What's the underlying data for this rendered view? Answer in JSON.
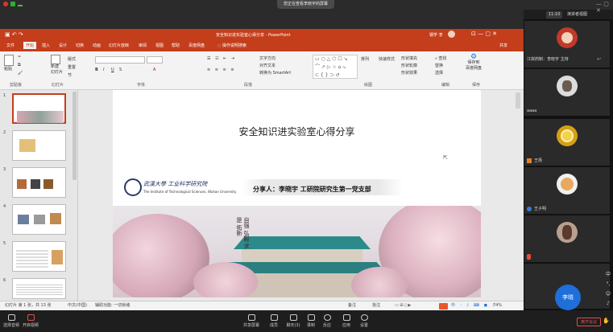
{
  "meeting": {
    "share_notice": "您正在查看李晓宇的屏幕",
    "time": "11:10",
    "layout_button": "演讲者视图",
    "chat_preview": "江岸药制：李晓宇 主持",
    "controls": [
      {
        "icon": "headset-icon",
        "label": "选择音频"
      },
      {
        "icon": "video-off-icon",
        "label": "开启视频"
      },
      {
        "icon": "screen-share-icon",
        "label": "共享屏幕"
      },
      {
        "icon": "members-icon",
        "label": "成员"
      },
      {
        "icon": "chat-icon",
        "label": "聊天(3)"
      },
      {
        "icon": "record-icon",
        "label": "录制"
      },
      {
        "icon": "reactions-icon",
        "label": "反应"
      },
      {
        "icon": "apps-icon",
        "label": "应用"
      },
      {
        "icon": "settings-icon",
        "label": "设置"
      }
    ],
    "leave_label": "离开会议",
    "raise_hand_label": "举手",
    "participants": [
      {
        "name": "",
        "color": "#c0392b"
      },
      {
        "name": "aaaa",
        "color": "#5a5a5a"
      },
      {
        "name": "王扬",
        "color": "#d4a017"
      },
      {
        "name": "王子明",
        "color": "#e8a860"
      },
      {
        "name": "",
        "color": "#7a5a4a"
      },
      {
        "name": "李晓",
        "color": "#1e6fd9"
      }
    ]
  },
  "ppt": {
    "window_title": "安全知识进实验室心得分享 - PowerPoint",
    "user": "钢学 李",
    "share_label": "共享",
    "tabs": [
      "文件",
      "开始",
      "插入",
      "设计",
      "切换",
      "动画",
      "幻灯片放映",
      "审阅",
      "视图",
      "帮助",
      "百度网盘",
      "操作说明搜索"
    ],
    "active_tab": "开始",
    "ribbon_groups": [
      "剪贴板",
      "幻灯片",
      "字体",
      "段落",
      "绘图",
      "编辑",
      "保存"
    ],
    "ribbon_items": {
      "paste": "粘贴",
      "new_slide": "新建\n幻灯片",
      "layout": "版式",
      "reset": "重置",
      "section": "节",
      "text_direction": "文字方向",
      "align_text": "对齐文本",
      "smartart": "转换为 SmartArt",
      "arrange": "排列",
      "quick_styles": "快速样式",
      "shape_fill": "形状填充",
      "shape_outline": "形状轮廓",
      "shape_effects": "形状效果",
      "find": "查找",
      "replace": "替换",
      "select": "选择",
      "save_to_baidu": "保存到\n百度网盘"
    },
    "status": {
      "slide_counter": "幻灯片 第 1 张，共 13 张",
      "language": "中文(中国)",
      "accessibility": "辅助功能: 一切就绪",
      "notes": "备注",
      "comments": "批注",
      "zoom": "74%"
    },
    "thumbnails": [
      {
        "num": "1",
        "selected": true
      },
      {
        "num": "2",
        "selected": false
      },
      {
        "num": "3",
        "selected": false
      },
      {
        "num": "4",
        "selected": false
      },
      {
        "num": "5",
        "selected": false
      },
      {
        "num": "6",
        "selected": false
      }
    ]
  },
  "slide": {
    "title": "安全知识进实验室心得分享",
    "logo_text_cn": "武漢大學 工业科学研究院",
    "logo_text_en": "The Institute of Technological Sciences, Wuhan University",
    "speaker": "分享人：李晓宇 工研院研究生第一党支部",
    "calligraphy": "自强 弘毅 求是 拓新"
  }
}
